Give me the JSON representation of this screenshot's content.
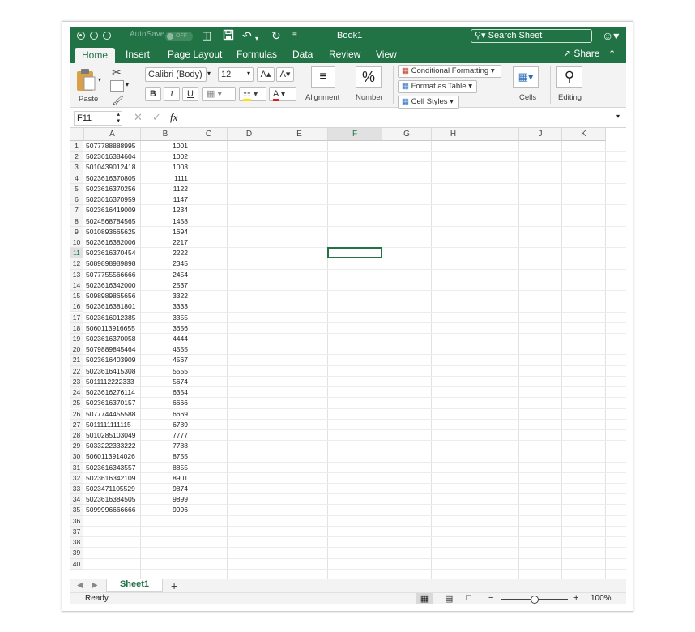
{
  "window": {
    "title": "Book1",
    "autosave_label": "AutoSave",
    "autosave_state": "OFF",
    "search_placeholder": "Search Sheet"
  },
  "tabs": [
    "Home",
    "Insert",
    "Page Layout",
    "Formulas",
    "Data",
    "Review",
    "View"
  ],
  "share_label": "Share",
  "ribbon": {
    "paste_label": "Paste",
    "font_name": "Calibri (Body)",
    "font_size": "12",
    "conditional_formatting": "Conditional Formatting",
    "format_as_table": "Format as Table",
    "cell_styles": "Cell Styles",
    "alignment_label": "Alignment",
    "number_label": "Number",
    "cells_label": "Cells",
    "editing_label": "Editing"
  },
  "formula_bar": {
    "name_box": "F11",
    "fx_label": "fx",
    "content": ""
  },
  "columns": [
    "A",
    "B",
    "C",
    "D",
    "E",
    "F",
    "G",
    "H",
    "I",
    "J",
    "K"
  ],
  "selected_cell": "F11",
  "rows": [
    [
      "5077788888995",
      "1001"
    ],
    [
      "5023616384604",
      "1002"
    ],
    [
      "5010439012418",
      "1003"
    ],
    [
      "5023616370805",
      "1111"
    ],
    [
      "5023616370256",
      "1122"
    ],
    [
      "5023616370959",
      "1147"
    ],
    [
      "5023616419009",
      "1234"
    ],
    [
      "5024568784565",
      "1458"
    ],
    [
      "5010893665625",
      "1694"
    ],
    [
      "5023616382006",
      "2217"
    ],
    [
      "5023616370454",
      "2222"
    ],
    [
      "5089898989898",
      "2345"
    ],
    [
      "5077755566666",
      "2454"
    ],
    [
      "5023616342000",
      "2537"
    ],
    [
      "5098989865656",
      "3322"
    ],
    [
      "5023616381801",
      "3333"
    ],
    [
      "5023616012385",
      "3355"
    ],
    [
      "5060113916655",
      "3656"
    ],
    [
      "5023616370058",
      "4444"
    ],
    [
      "5079889845464",
      "4555"
    ],
    [
      "5023616403909",
      "4567"
    ],
    [
      "5023616415308",
      "5555"
    ],
    [
      "5011112222333",
      "5674"
    ],
    [
      "5023616276114",
      "6354"
    ],
    [
      "5023616370157",
      "6666"
    ],
    [
      "5077744455588",
      "6669"
    ],
    [
      "5011111111115",
      "6789"
    ],
    [
      "5010285103049",
      "7777"
    ],
    [
      "5033222333222",
      "7788"
    ],
    [
      "5060113914026",
      "8755"
    ],
    [
      "5023616343557",
      "8855"
    ],
    [
      "5023616342109",
      "8901"
    ],
    [
      "5023471105529",
      "9874"
    ],
    [
      "5023616384505",
      "9899"
    ],
    [
      "5099996666666",
      "9996"
    ],
    [
      "",
      ""
    ],
    [
      "",
      ""
    ],
    [
      "",
      ""
    ],
    [
      "",
      ""
    ],
    [
      "",
      ""
    ]
  ],
  "sheet_tab": "Sheet1",
  "add_sheet": "+",
  "status": {
    "ready": "Ready",
    "zoom_minus": "−",
    "zoom_plus": "+",
    "zoom": "100%",
    "zoom_level": 0.5
  },
  "colors": {
    "accent": "#217346",
    "ribbon_bg": "#f3f3f3"
  }
}
